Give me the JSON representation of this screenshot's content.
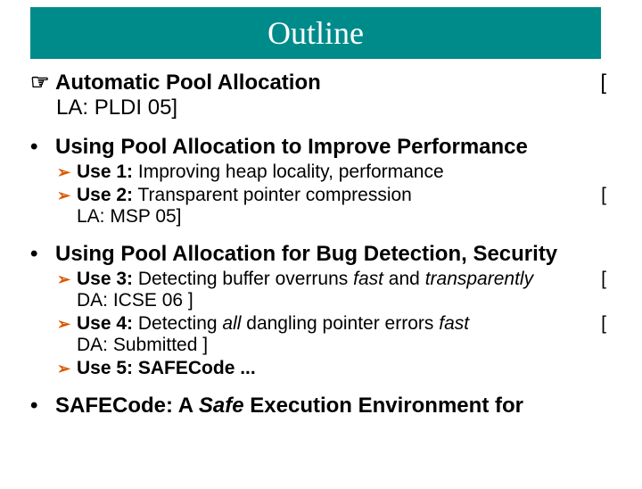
{
  "title": "Outline",
  "sections": {
    "s1": {
      "heading": "Automatic Pool Allocation",
      "bracket": "[",
      "ref": "LA: PLDI 05]"
    },
    "s2": {
      "heading": "Using Pool Allocation to Improve Performance",
      "u1_pre": "Use 1:",
      "u1_txt": " Improving heap locality, performance",
      "u2_pre": "Use 2:",
      "u2_txt": " Transparent pointer compression",
      "u2_bracket": "[",
      "u2_ref": "LA: MSP 05]"
    },
    "s3": {
      "heading": "Using Pool Allocation for Bug Detection, Security",
      "u3_pre": "Use 3:",
      "u3_txt1": " Detecting buffer overruns ",
      "u3_fast": "fast",
      "u3_and": " and ",
      "u3_trans": "transparently",
      "u3_bracket": "[",
      "u3_ref": "DA: ICSE 06 ]",
      "u4_pre": "Use 4:",
      "u4_txt1": " Detecting ",
      "u4_all": "all",
      "u4_txt2": " dangling pointer errors ",
      "u4_fast": "fast",
      "u4_bracket": "[",
      "u4_ref": "DA: Submitted ]",
      "u5_pre": "Use 5:",
      "u5_txt": " SAFECode ..."
    },
    "s4": {
      "heading_pre": "SAFECode: A ",
      "heading_safe": "Safe",
      "heading_post": " Execution Environment for"
    }
  }
}
